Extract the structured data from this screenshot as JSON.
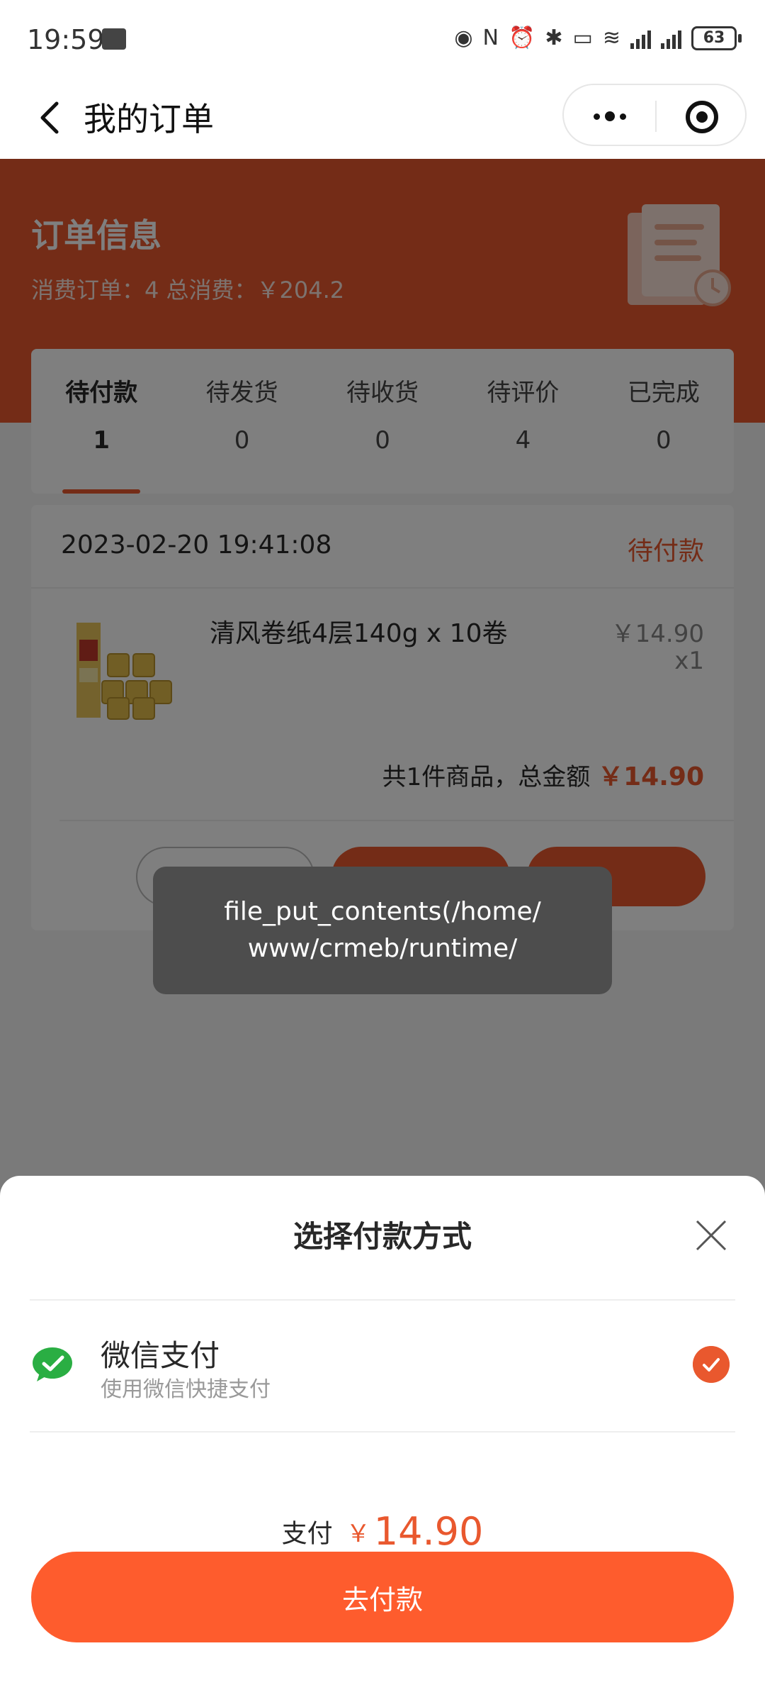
{
  "status_bar": {
    "time": "19:59",
    "battery": "63",
    "network": "4G"
  },
  "nav": {
    "title": "我的订单"
  },
  "order_info": {
    "title": "订单信息",
    "summary": "消费订单：4 总消费：￥204.2"
  },
  "tabs": [
    {
      "label": "待付款",
      "count": "1",
      "active": true
    },
    {
      "label": "待发货",
      "count": "0",
      "active": false
    },
    {
      "label": "待收货",
      "count": "0",
      "active": false
    },
    {
      "label": "待评价",
      "count": "4",
      "active": false
    },
    {
      "label": "已完成",
      "count": "0",
      "active": false
    }
  ],
  "order": {
    "date": "2023-02-20 19:41:08",
    "status": "待付款",
    "product_name": "清风卷纸4层140g x 10卷",
    "price": "￥14.90",
    "quantity": "x1",
    "total_label": "共1件商品，总金额",
    "total_amount": "￥14.90"
  },
  "toast": {
    "line1": "file_put_contents(/home/",
    "line2": "www/crmeb/runtime/"
  },
  "payment": {
    "title": "选择付款方式",
    "method_name": "微信支付",
    "method_desc": "使用微信快捷支付",
    "amount_label": "支付",
    "amount_symbol": "￥",
    "amount_value": "14.90",
    "button_label": "去付款"
  },
  "colors": {
    "accent": "#e9582e",
    "pay_button": "#fe5c2d",
    "wechat_green": "#2aae43"
  }
}
